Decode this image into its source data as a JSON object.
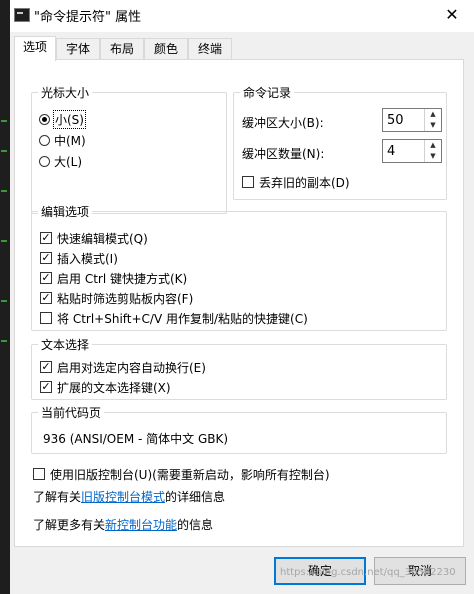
{
  "window": {
    "title": "\"命令提示符\" 属性",
    "close_glyph": "✕"
  },
  "tabs": [
    {
      "label": "选项",
      "active": true
    },
    {
      "label": "字体",
      "active": false
    },
    {
      "label": "布局",
      "active": false
    },
    {
      "label": "颜色",
      "active": false
    },
    {
      "label": "终端",
      "active": false
    }
  ],
  "cursor_size": {
    "legend": "光标大小",
    "options": [
      {
        "label": "小(S)",
        "selected": true
      },
      {
        "label": "中(M)",
        "selected": false
      },
      {
        "label": "大(L)",
        "selected": false
      }
    ]
  },
  "command_history": {
    "legend": "命令记录",
    "buffer_size_label": "缓冲区大小(B):",
    "buffer_size_value": "50",
    "buffer_count_label": "缓冲区数量(N):",
    "buffer_count_value": "4",
    "discard_label": "丢弃旧的副本(D)",
    "discard_checked": false
  },
  "edit_options": {
    "legend": "编辑选项",
    "items": [
      {
        "label": "快速编辑模式(Q)",
        "checked": true
      },
      {
        "label": "插入模式(I)",
        "checked": true
      },
      {
        "label": "启用 Ctrl 键快捷方式(K)",
        "checked": true
      },
      {
        "label": "粘贴时筛选剪贴板内容(F)",
        "checked": true
      },
      {
        "label": "将 Ctrl+Shift+C/V 用作复制/粘贴的快捷键(C)",
        "checked": false
      }
    ]
  },
  "text_selection": {
    "legend": "文本选择",
    "items": [
      {
        "label": "启用对选定内容自动换行(E)",
        "checked": true
      },
      {
        "label": "扩展的文本选择键(X)",
        "checked": true
      }
    ]
  },
  "code_page": {
    "legend": "当前代码页",
    "value": "936   (ANSI/OEM - 简体中文 GBK)"
  },
  "legacy": {
    "label": "使用旧版控制台(U)(需要重新启动，影响所有控制台)",
    "checked": false,
    "info1_prefix": "了解有关",
    "info1_link": "旧版控制台模式",
    "info1_suffix": "的详细信息",
    "info2_prefix": "了解更多有关",
    "info2_link": "新控制台功能",
    "info2_suffix": "的信息"
  },
  "buttons": {
    "ok": "确定",
    "cancel": "取消"
  },
  "watermark": "https://blog.csdn.net/qq_36502230",
  "icons": {
    "checkmark": "✓",
    "spin_up": "▲",
    "spin_down": "▼"
  }
}
